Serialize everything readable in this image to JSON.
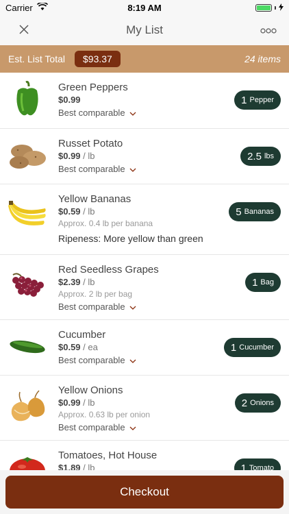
{
  "status": {
    "carrier": "Carrier",
    "time": "8:19 AM"
  },
  "nav": {
    "title": "My List"
  },
  "summary": {
    "label": "Est. List Total",
    "total": "$93.37",
    "count": "24 items"
  },
  "items": [
    {
      "name": "Green Peppers",
      "price": "$0.99",
      "unit": "",
      "approx": "",
      "substitution": "Best comparable",
      "ripeness": "",
      "qty": "1",
      "qty_unit": "Pepper"
    },
    {
      "name": "Russet Potato",
      "price": "$0.99",
      "unit": "/ lb",
      "approx": "",
      "substitution": "Best comparable",
      "ripeness": "",
      "qty": "2.5",
      "qty_unit": "lbs"
    },
    {
      "name": "Yellow Bananas",
      "price": "$0.59",
      "unit": "/ lb",
      "approx": "Approx. 0.4 lb per banana",
      "substitution": "",
      "ripeness": "Ripeness: More yellow than green",
      "qty": "5",
      "qty_unit": "Bananas"
    },
    {
      "name": "Red Seedless Grapes",
      "price": "$2.39",
      "unit": "/ lb",
      "approx": "Approx. 2 lb per bag",
      "substitution": "Best comparable",
      "ripeness": "",
      "qty": "1",
      "qty_unit": "Bag"
    },
    {
      "name": "Cucumber",
      "price": "$0.59",
      "unit": "/ ea",
      "approx": "",
      "substitution": "Best comparable",
      "ripeness": "",
      "qty": "1",
      "qty_unit": "Cucumber"
    },
    {
      "name": "Yellow Onions",
      "price": "$0.99",
      "unit": "/ lb",
      "approx": "Approx. 0.63 lb per onion",
      "substitution": "Best comparable",
      "ripeness": "",
      "qty": "2",
      "qty_unit": "Onions"
    },
    {
      "name": "Tomatoes, Hot House",
      "price": "$1.89",
      "unit": "/ lb",
      "approx": "",
      "substitution": "",
      "ripeness": "",
      "qty": "1",
      "qty_unit": "Tomato"
    }
  ],
  "checkout": {
    "label": "Checkout"
  },
  "colors": {
    "accent": "#7a2e10",
    "banner": "#c8996b",
    "quantity_pill": "#1e3b32"
  },
  "icons": {
    "close": "close-icon",
    "more": "more-icon",
    "substitution": "chevron-down-icon"
  }
}
